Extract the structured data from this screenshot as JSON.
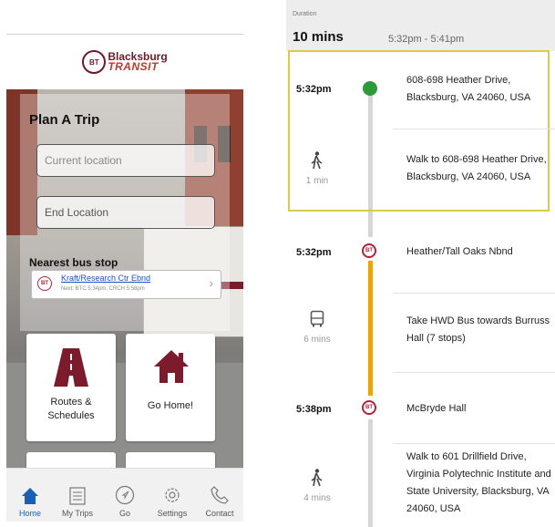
{
  "brand": {
    "badge": "BT",
    "line1": "Blacksburg",
    "line2": "TRANSIT",
    "colors": {
      "maroon": "#6d1a2c",
      "accent": "#1a5fb4",
      "highlight": "#e0c94a",
      "route": "#e8a317",
      "origin": "#2e9b3a"
    }
  },
  "plan": {
    "title": "Plan A Trip",
    "current_placeholder": "Current location",
    "end_placeholder": "End Location"
  },
  "nearest": {
    "heading": "Nearest bus stop",
    "stop_name": "Kraft/Research Ctr Ebnd",
    "next_info": "Next: BTC 5:34pm, CRCH 5:58pm"
  },
  "tiles": {
    "routes_line1": "Routes &",
    "routes_line2": "Schedules",
    "home": "Go Home!"
  },
  "tabs": [
    {
      "label": "Home",
      "icon": "home-icon"
    },
    {
      "label": "My Trips",
      "icon": "list-icon"
    },
    {
      "label": "Go",
      "icon": "navigate-icon"
    },
    {
      "label": "Settings",
      "icon": "gear-icon"
    },
    {
      "label": "Contact",
      "icon": "phone-icon"
    }
  ],
  "trip": {
    "duration_label": "Duration",
    "duration": "10 mins",
    "range": "5:32pm - 5:41pm",
    "steps": [
      {
        "time": "5:32pm",
        "line1": "608-698 Heather Drive,",
        "line2": "Blacksburg, VA 24060, USA"
      },
      {
        "sub": "1 min",
        "line1": "Walk to 608-698 Heather Drive,",
        "line2": "Blacksburg, VA 24060, USA"
      },
      {
        "time": "5:32pm",
        "line1": "Heather/Tall Oaks Nbnd"
      },
      {
        "sub": "6 mins",
        "line1": "Take HWD Bus towards Burruss",
        "line2": "Hall (7 stops)"
      },
      {
        "time": "5:38pm",
        "line1": "McBryde Hall"
      },
      {
        "sub": "4 mins",
        "line1": "Walk to 601 Drillfield Drive,",
        "line2": "Virginia Polytechnic Institute and",
        "line3": "State University, Blacksburg, VA",
        "line4": "24060, USA"
      }
    ]
  }
}
